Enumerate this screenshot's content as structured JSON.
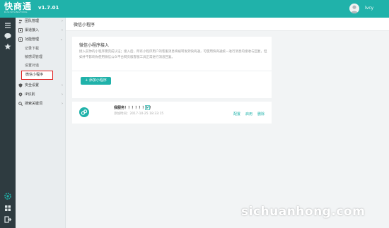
{
  "app": {
    "logo": "快商通",
    "logo_sub": "KUAISHANGTONG",
    "version": "v1.7.01",
    "username": "lvcy",
    "accent": "#20b2aa"
  },
  "rail": {
    "icons": [
      "menu-icon",
      "chat-icon",
      "star-icon",
      "settings-icon",
      "apps-icon",
      "exit-icon"
    ]
  },
  "menu": {
    "items": [
      {
        "label": "团队管理",
        "icon": "team-icon",
        "arrow": "›"
      },
      {
        "label": "渠道接入",
        "icon": "channel-icon",
        "arrow": "›"
      },
      {
        "label": "功能管理",
        "icon": "function-icon",
        "arrow": "⌄"
      }
    ],
    "sub_items": [
      "记录下载",
      "敏感词管理",
      "设置对话"
    ],
    "active_item": "微信小程序",
    "items_after": [
      {
        "label": "安全设置",
        "icon": "shield-icon",
        "arrow": "›"
      },
      {
        "label": "IP识别",
        "icon": "ip-icon",
        "arrow": "›"
      },
      {
        "label": "搜索关键词",
        "icon": "search-icon",
        "arrow": "›"
      }
    ]
  },
  "content": {
    "header_title": "微信小程序",
    "panel_title": "微信小程序接入",
    "panel_desc": "接入前你的小程序需完成认证；接入后，所有小程序用户的客服消息将被转发到快商通，可使用快商通统一进行消息的接收与回复，但如并不影响你使用微信公众平台网页版客服工具正常进行消息回复。",
    "add_button": "+ 添加小程序"
  },
  "miniprogram": {
    "name": "我服务！！！！！！！！",
    "time": "添加时间：2017-10-25 18:33:15",
    "actions": [
      "配置",
      "启用",
      "删除"
    ]
  },
  "watermark": "sichuanhong.com"
}
